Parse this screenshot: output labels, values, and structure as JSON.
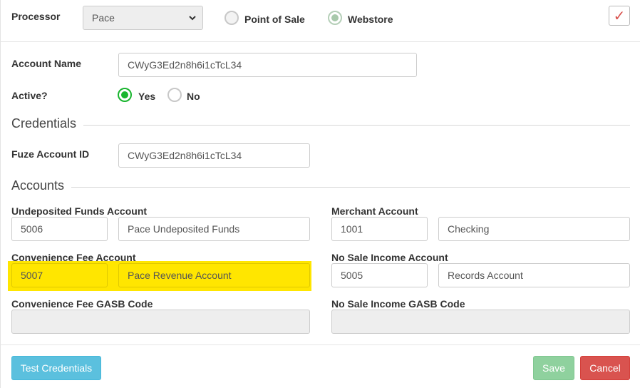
{
  "header": {
    "processor_label": "Processor",
    "processor_value": "Pace",
    "radio_point_of_sale": "Point of Sale",
    "radio_webstore": "Webstore",
    "selected_channel": "Webstore",
    "check_mark": "✓"
  },
  "account": {
    "name_label": "Account Name",
    "name_value": "CWyG3Ed2n8h6i1cTcL34",
    "active_label": "Active?",
    "yes_label": "Yes",
    "no_label": "No",
    "active_selected": "Yes"
  },
  "credentials": {
    "section_title": "Credentials",
    "fuze_label": "Fuze Account ID",
    "fuze_value": "CWyG3Ed2n8h6i1cTcL34"
  },
  "accounts": {
    "section_title": "Accounts",
    "undeposited_label": "Undeposited Funds Account",
    "undeposited_number": "5006",
    "undeposited_name": "Pace Undeposited Funds",
    "merchant_label": "Merchant Account",
    "merchant_number": "1001",
    "merchant_name": "Checking",
    "conv_fee_label": "Convenience Fee Account",
    "conv_fee_number": "5007",
    "conv_fee_name": "Pace Revenue Account",
    "no_sale_label": "No Sale Income Account",
    "no_sale_number": "5005",
    "no_sale_name": "Records Account",
    "conv_gasb_label": "Convenience Fee GASB Code",
    "conv_gasb_value": "",
    "no_sale_gasb_label": "No Sale Income GASB Code",
    "no_sale_gasb_value": ""
  },
  "footer": {
    "test_label": "Test Credentials",
    "save_label": "Save",
    "cancel_label": "Cancel"
  },
  "colors": {
    "highlight": "#ffe600",
    "test_button": "#5bc0de",
    "save_button": "#8fd19e",
    "cancel_button": "#d9534f",
    "radio_selected": "#19b52e"
  }
}
